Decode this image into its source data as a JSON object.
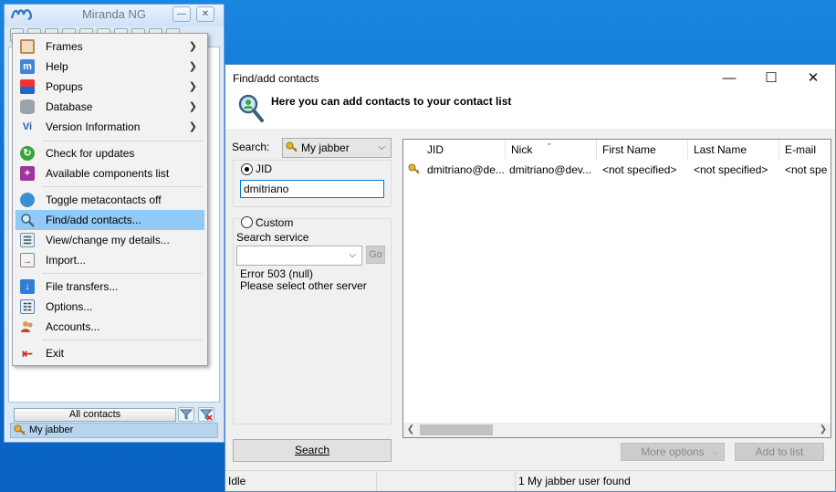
{
  "miranda": {
    "title": "Miranda NG",
    "minimize_glyph": "—",
    "close_glyph": "✕",
    "all_contacts": "All contacts",
    "status_account": "My jabber",
    "status_icon": "key-icon"
  },
  "menu": {
    "items": [
      {
        "label": "Frames",
        "icon": "frames-icon",
        "submenu": true
      },
      {
        "label": "Help",
        "icon": "miranda-help-icon",
        "submenu": true
      },
      {
        "label": "Popups",
        "icon": "popups-icon",
        "submenu": true
      },
      {
        "label": "Database",
        "icon": "database-icon",
        "submenu": true
      },
      {
        "label": "Version Information",
        "icon": "version-info-icon",
        "submenu": true
      },
      {
        "label": "Check for updates",
        "icon": "update-icon"
      },
      {
        "label": "Available components list",
        "icon": "components-icon"
      },
      {
        "label": "Toggle metacontacts off",
        "icon": "metacontacts-icon"
      },
      {
        "label": "Find/add contacts...",
        "icon": "find-contacts-icon",
        "highlighted": true
      },
      {
        "label": "View/change my details...",
        "icon": "my-details-icon"
      },
      {
        "label": "Import...",
        "icon": "import-icon"
      },
      {
        "label": "File transfers...",
        "icon": "file-transfer-icon"
      },
      {
        "label": "Options...",
        "icon": "options-icon"
      },
      {
        "label": "Accounts...",
        "icon": "accounts-icon"
      },
      {
        "label": "Exit",
        "icon": "exit-icon"
      }
    ],
    "highlight_color": "#91c9f7"
  },
  "dialog": {
    "title": "Find/add contacts",
    "header_text": "Here you can add contacts to your contact list",
    "controls": {
      "minimize": "—",
      "maximize": "☐",
      "close": "✕"
    },
    "search_label": "Search:",
    "search_account": "My jabber",
    "jid_label": "JID",
    "jid_value": "dmitriano",
    "custom_label": "Custom",
    "search_service_label": "Search service",
    "service_value": "",
    "go_button": "Go",
    "error_line1": "Error 503 (null)",
    "error_line2": "Please select other server",
    "search_button": "Search",
    "more_options_button": "More options",
    "add_to_list_button": "Add to list",
    "results": {
      "columns": [
        "JID",
        "Nick",
        "First Name",
        "Last Name",
        "E-mail"
      ],
      "rows": [
        {
          "jid": "dmitriano@de...",
          "nick": "dmitriano@dev...",
          "first_name": "<not specified>",
          "last_name": "<not specified>",
          "email": "<not spe"
        }
      ]
    },
    "status": {
      "state": "Idle",
      "middle": "",
      "result": "1 My jabber user found"
    }
  },
  "colors": {
    "selection": "#91c9f7",
    "focus_border": "#0078d7",
    "desktop": "#0a63c4"
  }
}
